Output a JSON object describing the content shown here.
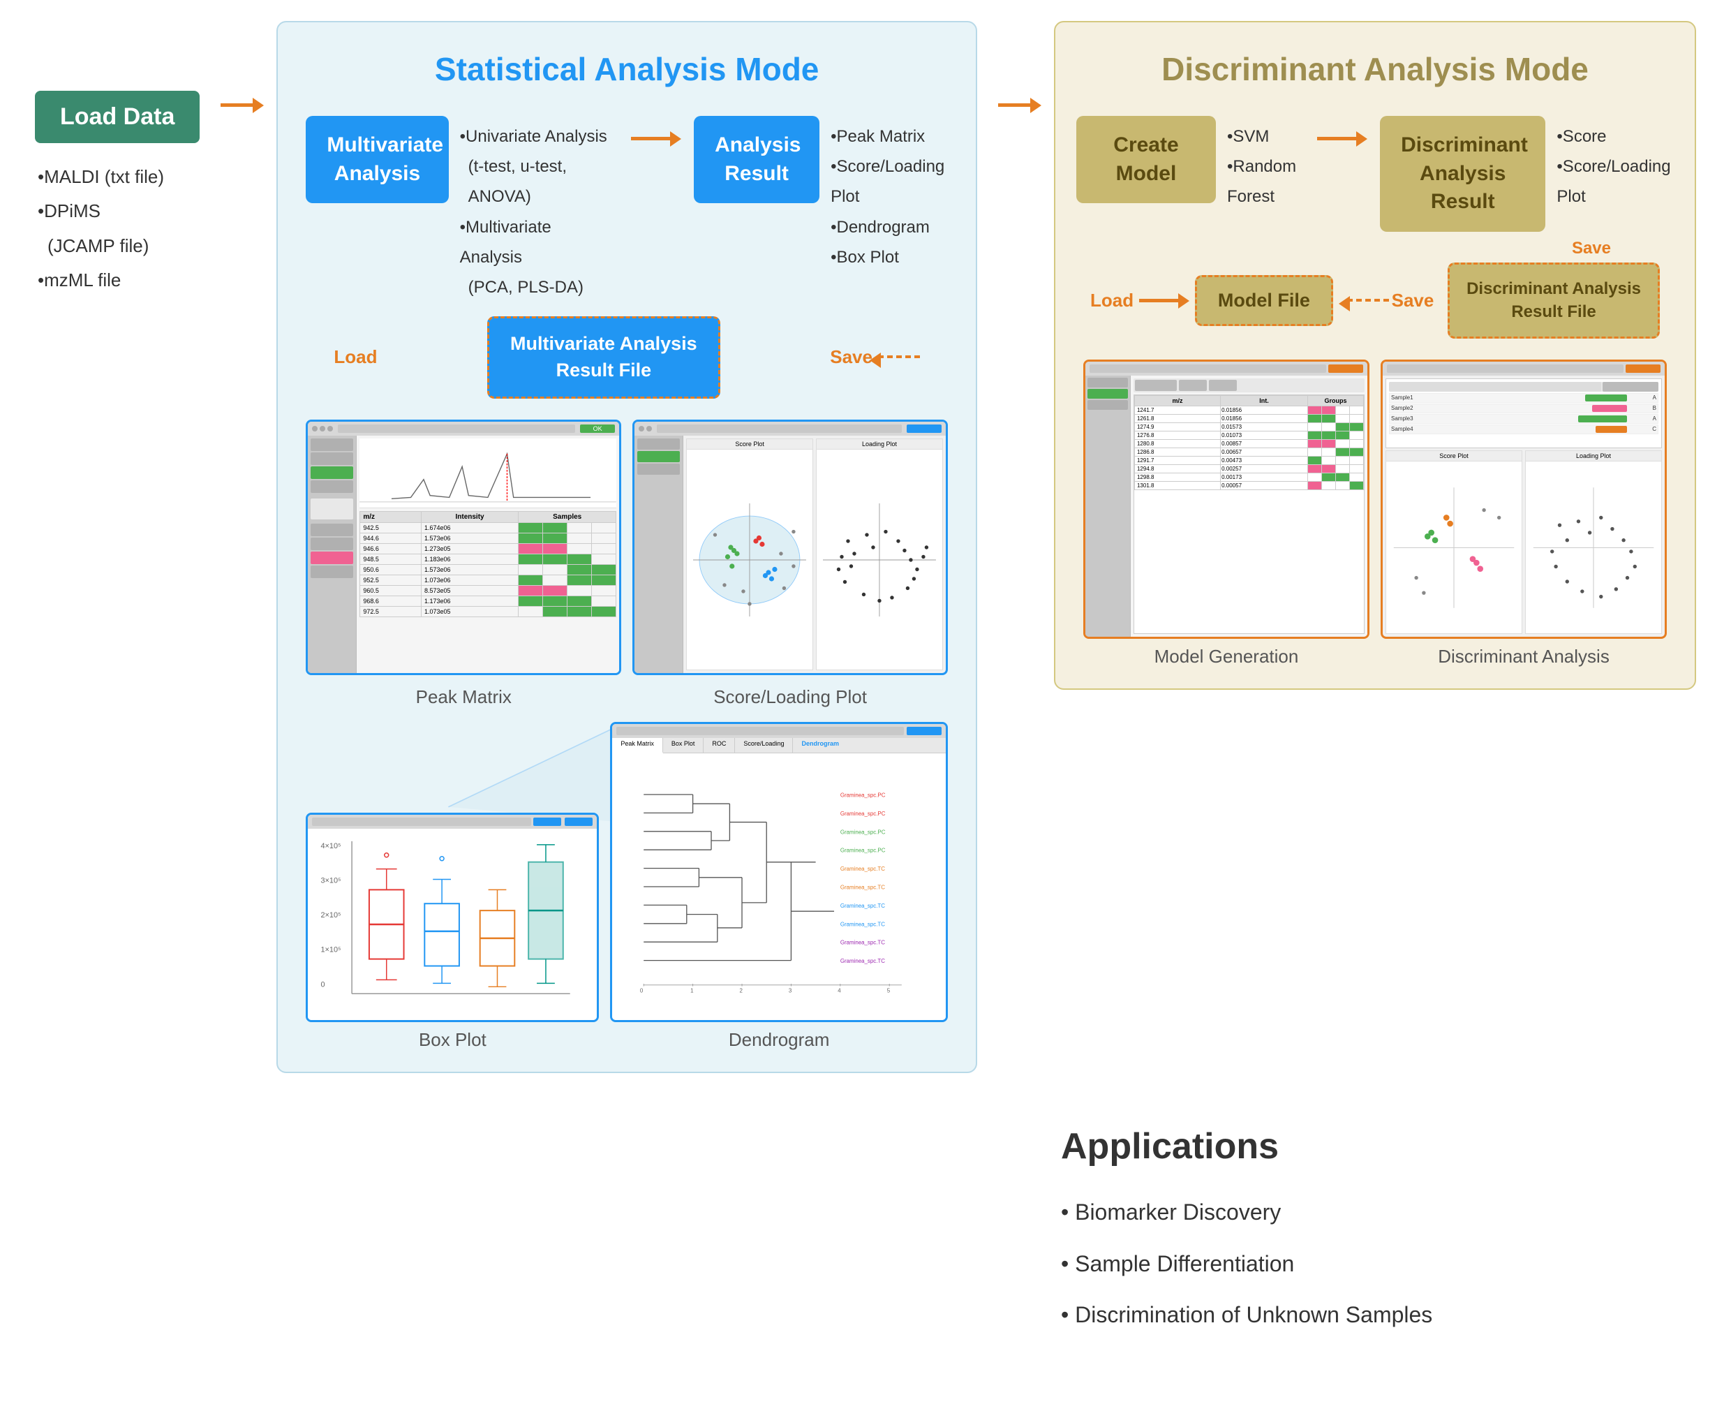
{
  "stat_panel": {
    "title": "Statistical Analysis Mode",
    "multivariate_box": "Multivariate\nAnalysis",
    "analysis_result_box": "Analysis\nResult",
    "result_file_box": "Multivariate Analysis\nResult File",
    "load_label": "Load",
    "save_label": "Save",
    "multivariate_items": [
      "Univariate Analysis",
      "(t-test, u-test, ANOVA)",
      "Multivariate Analysis",
      "(PCA, PLS-DA)"
    ],
    "result_items": [
      "Peak Matrix",
      "Score/Loading Plot",
      "Dendrogram",
      "Box Plot"
    ]
  },
  "disc_panel": {
    "title": "Discriminant Analysis Mode",
    "create_model_box": "Create Model",
    "disc_result_box": "Discriminant\nAnalysis Result",
    "model_file_box": "Model File",
    "disc_result_file_box": "Discriminant Analysis\nResult File",
    "load_label": "Load",
    "save_label": "Save",
    "save_label2": "Save",
    "create_model_items": [
      "SVM",
      "Random Forest"
    ],
    "disc_result_items": [
      "Score",
      "Score/Loading Plot"
    ]
  },
  "load_data": {
    "box_label": "Load Data",
    "items": [
      "MALDI (txt file)",
      "DPiMS",
      "(JCAMP file)",
      "mzML file"
    ]
  },
  "screenshots": {
    "peak_matrix_label": "Peak Matrix",
    "score_loading_label": "Score/Loading Plot",
    "box_plot_label": "Box Plot",
    "dendrogram_label": "Dendrogram",
    "model_generation_label": "Model Generation",
    "discriminant_analysis_label": "Discriminant Analysis"
  },
  "applications": {
    "title": "Applications",
    "items": [
      "Biomarker Discovery",
      "Sample Differentiation",
      "Discrimination of Unknown Samples"
    ]
  }
}
